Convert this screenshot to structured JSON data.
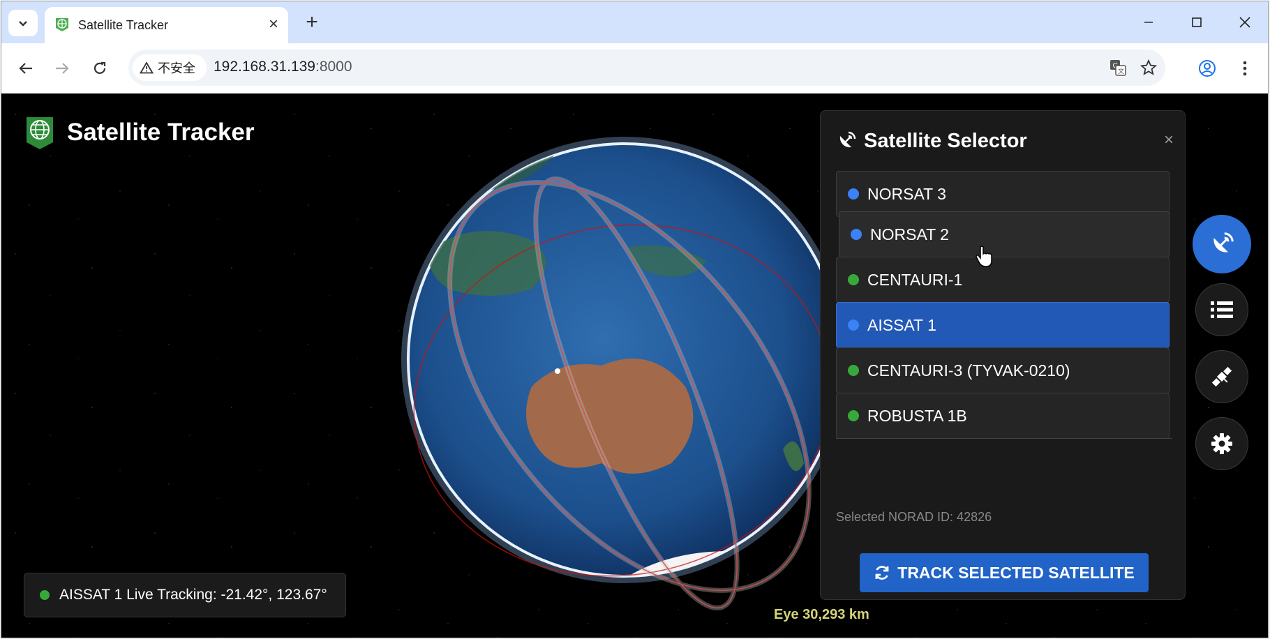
{
  "browser": {
    "tab_title": "Satellite Tracker",
    "security_label": "不安全",
    "url_host": "192.168.31.139",
    "url_port": ":8000"
  },
  "app": {
    "title": "Satellite Tracker"
  },
  "selector": {
    "title": "Satellite Selector",
    "close": "×",
    "satellites": [
      {
        "name": "NORSAT 3",
        "color": "#3b82f6",
        "selected": false
      },
      {
        "name": "NORSAT 2",
        "color": "#3b82f6",
        "selected": false
      },
      {
        "name": "CENTAURI-1",
        "color": "#37a93b",
        "selected": false
      },
      {
        "name": "AISSAT 1",
        "color": "#3b82f6",
        "selected": true
      },
      {
        "name": "CENTAURI-3 (TYVAK-0210)",
        "color": "#37a93b",
        "selected": false
      },
      {
        "name": "ROBUSTA 1B",
        "color": "#37a93b",
        "selected": false
      }
    ],
    "norad_text": "Selected NORAD ID: 42826",
    "track_button": "TRACK SELECTED SATELLITE"
  },
  "status": {
    "live_tracking": "AISSAT 1 Live Tracking: -21.42°, 123.67°",
    "eye": "Eye  30,293 km"
  },
  "fabs": [
    {
      "icon": "satellite-dish-icon",
      "active": true
    },
    {
      "icon": "list-icon",
      "active": false
    },
    {
      "icon": "satellite-icon",
      "active": false
    },
    {
      "icon": "gear-icon",
      "active": false
    }
  ],
  "colors": {
    "accent": "#2163c7",
    "tracking_dot": "#37a93b",
    "orbit": "#d01010"
  }
}
